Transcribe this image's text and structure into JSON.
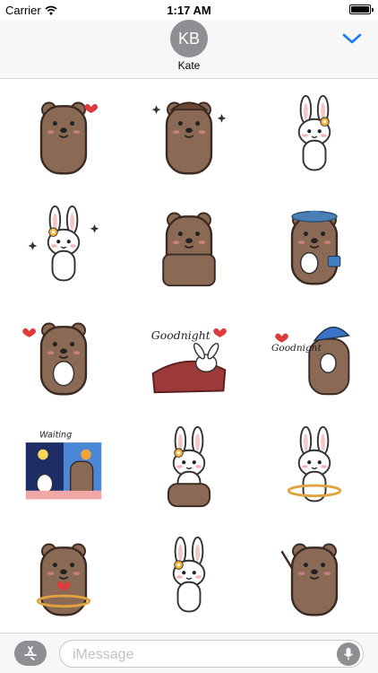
{
  "status_bar": {
    "carrier": "Carrier",
    "time": "1:17 AM",
    "battery_level": 1.0,
    "wifi_icon": "wifi-icon",
    "battery_icon": "battery-icon"
  },
  "header": {
    "avatar_initials": "KB",
    "contact_name": "Kate",
    "expand_icon": "chevron-down-icon",
    "accent_color": "#1a7cf5"
  },
  "stickers": [
    {
      "name": "bear-blush-heart",
      "subject": "bear"
    },
    {
      "name": "bear-hat-sparkle",
      "subject": "bear"
    },
    {
      "name": "bunny-flower-surprised",
      "subject": "bunny"
    },
    {
      "name": "bunny-flower-sparkle",
      "subject": "bunny"
    },
    {
      "name": "bear-peek",
      "subject": "bear"
    },
    {
      "name": "bear-blue-hat-bunny-bag",
      "subject": "bear"
    },
    {
      "name": "bear-hug-bunny-heart",
      "subject": "bear"
    },
    {
      "name": "bunny-in-bed",
      "subject": "bunny",
      "caption": "Goodnight"
    },
    {
      "name": "bear-nightcap-bunny",
      "subject": "bear",
      "caption": "Goodnight"
    },
    {
      "name": "bear-bunny-window",
      "subject": "bear",
      "caption": "Waiting"
    },
    {
      "name": "bunny-on-bear",
      "subject": "bunny"
    },
    {
      "name": "bunny-hula-hoop",
      "subject": "bunny"
    },
    {
      "name": "bear-hula-hoop-heart",
      "subject": "bear"
    },
    {
      "name": "bunny-standing-flower",
      "subject": "bunny"
    },
    {
      "name": "bear-waving",
      "subject": "bear"
    }
  ],
  "compose": {
    "placeholder": "iMessage",
    "app_store_icon": "app-store-icon",
    "mic_icon": "microphone-icon"
  }
}
